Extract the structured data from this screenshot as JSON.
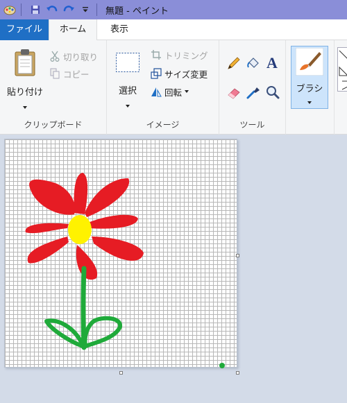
{
  "window": {
    "title": "無題 - ペイント"
  },
  "quick_access": {
    "icons": [
      "paint-app-icon",
      "save-icon",
      "undo-icon",
      "redo-icon",
      "customize-dropdown-icon"
    ]
  },
  "tabs": {
    "file": "ファイル",
    "home": "ホーム",
    "view": "表示"
  },
  "ribbon": {
    "clipboard": {
      "paste": "貼り付け",
      "cut": "切り取り",
      "copy": "コピー",
      "label": "クリップボード"
    },
    "image": {
      "select": "選択",
      "crop": "トリミング",
      "resize": "サイズ変更",
      "rotate": "回転",
      "label": "イメージ"
    },
    "tools": {
      "label": "ツール",
      "icons": [
        "pencil-icon",
        "fill-bucket-icon",
        "text-icon",
        "eraser-icon",
        "color-picker-icon",
        "magnifier-icon"
      ]
    },
    "brush": {
      "label": "ブラシ"
    }
  },
  "colors": {
    "titlebar": "#8a8ed8",
    "file_tab": "#1f6fc5",
    "petal_red": "#e61c24",
    "flower_center": "#fff200",
    "stem_green": "#1faa3a",
    "workspace": "#d3dbe8"
  }
}
